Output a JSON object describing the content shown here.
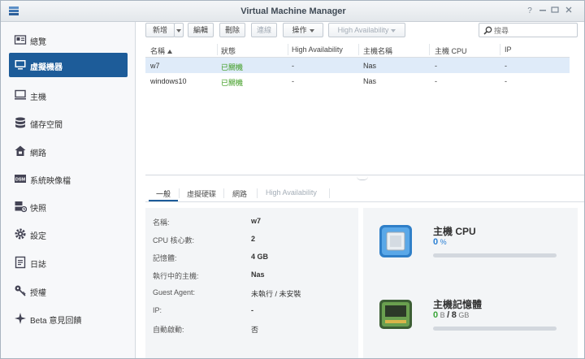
{
  "window": {
    "title": "Virtual Machine Manager"
  },
  "sidebar": {
    "items": [
      {
        "label": "總覽",
        "icon": "overview-icon",
        "active": false
      },
      {
        "label": "虛擬機器",
        "icon": "virtual-machine-icon",
        "active": true
      },
      {
        "label": "主機",
        "icon": "host-icon",
        "active": false
      },
      {
        "label": "儲存空間",
        "icon": "storage-icon",
        "active": false
      },
      {
        "label": "網路",
        "icon": "network-icon",
        "active": false
      },
      {
        "label": "系統映像檔",
        "icon": "image-icon",
        "active": false
      },
      {
        "label": "快照",
        "icon": "snapshot-icon",
        "active": false
      },
      {
        "label": "設定",
        "icon": "settings-icon",
        "active": false
      },
      {
        "label": "日誌",
        "icon": "log-icon",
        "active": false
      },
      {
        "label": "授權",
        "icon": "license-key-icon",
        "active": false
      },
      {
        "label": "Beta 意見回饋",
        "icon": "feedback-icon",
        "active": false
      }
    ]
  },
  "toolbar": {
    "new_label": "新增",
    "edit_label": "編輯",
    "delete_label": "刪除",
    "connect_label": "連線",
    "action_label": "操作",
    "ha_label": "High Availability",
    "search_placeholder": "搜尋"
  },
  "grid": {
    "columns": [
      "名稱",
      "狀態",
      "High Availability",
      "主機名稱",
      "主機 CPU",
      "IP"
    ],
    "rows": [
      {
        "name": "w7",
        "status": "已關機",
        "ha": "-",
        "host": "Nas",
        "cpu": "-",
        "ip": "-"
      },
      {
        "name": "windows10",
        "status": "已關機",
        "ha": "-",
        "host": "Nas",
        "cpu": "-",
        "ip": "-"
      }
    ]
  },
  "tabs": [
    "一般",
    "虛擬硬碟",
    "網路",
    "High Availability"
  ],
  "details": [
    {
      "label": "名稱:",
      "value": "w7"
    },
    {
      "label": "CPU 核心數:",
      "value": "2"
    },
    {
      "label": "記憶體:",
      "value": "4 GB"
    },
    {
      "label": "執行中的主機:",
      "value": "Nas"
    },
    {
      "label": "Guest Agent:",
      "value": "未執行 / 未安裝"
    },
    {
      "label": "IP:",
      "value": "-"
    },
    {
      "label": "自動啟動:",
      "value": "否"
    }
  ],
  "resources": {
    "cpu": {
      "title": "主機 CPU",
      "value": "0",
      "unit": "%",
      "percent": 0
    },
    "memory": {
      "title": "主機記憶體",
      "used": "0",
      "used_unit": "B",
      "separator": "/",
      "total": "8",
      "total_unit": "GB",
      "percent": 0
    }
  },
  "colors": {
    "accent": "#1d5c99",
    "status_off": "#3a9a1d",
    "cpu_value": "#2a7fd4"
  }
}
